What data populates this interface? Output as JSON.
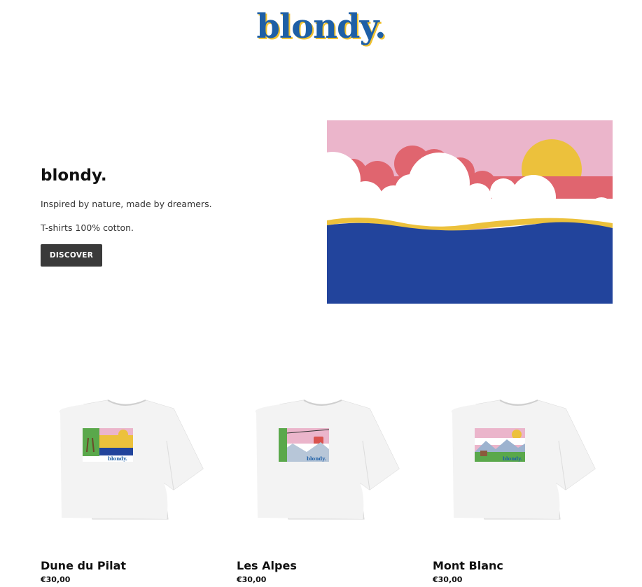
{
  "header": {
    "logo_text": "blondy."
  },
  "hero": {
    "title": "blondy.",
    "tagline": "Inspired by nature, made by dreamers.",
    "material": "T-shirts 100% cotton.",
    "cta_label": "DISCOVER"
  },
  "products": [
    {
      "name": "Dune du Pilat",
      "price": "€30,00",
      "print_brand": "blondy."
    },
    {
      "name": "Les Alpes",
      "price": "€30,00",
      "print_brand": "blondy."
    },
    {
      "name": "Mont Blanc",
      "price": "€30,00",
      "print_brand": "blondy."
    }
  ],
  "colors": {
    "brand_blue": "#1e5fa6",
    "brand_yellow": "#f0c12f",
    "sky_pink": "#ebb5cb",
    "cloud_red": "#e0656f",
    "sea_blue": "#22449c",
    "button_dark": "#3a3a3a"
  }
}
